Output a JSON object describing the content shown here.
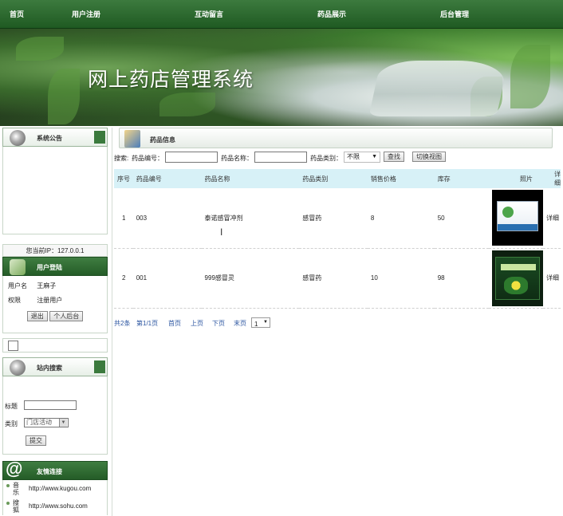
{
  "nav": [
    "首页",
    "用户注册",
    "互动留言",
    "药品展示",
    "后台管理"
  ],
  "banner": {
    "title": "网上药店管理系统"
  },
  "sidebar": {
    "notice_title": "系统公告",
    "ip_text": "您当前IP：127.0.0.1",
    "login_title": "用户登陆",
    "username_label": "用户名",
    "username_value": "王麻子",
    "role_label": "权限",
    "role_value": "注册用户",
    "logout_label": "退出",
    "backend_label": "个人后台",
    "search_title": "站内搜索",
    "search_title_label": "标题",
    "search_type_label": "类别",
    "search_type_value": "门店活动",
    "submit_label": "提交",
    "links_title": "友情连接",
    "links": [
      {
        "name": "音乐",
        "url": "http://www.kugou.com"
      },
      {
        "name": "搜狐",
        "url": "http://www.sohu.com"
      }
    ]
  },
  "main": {
    "panel_title": "药品信息",
    "filter": {
      "prefix": "搜索:",
      "code_label": "药品编号：",
      "name_label": "药品名称：",
      "type_label": "药品类别：",
      "type_value": "不限",
      "search_button": "查找",
      "switch_button": "切换视图"
    },
    "columns": [
      "序号",
      "药品编号",
      "药品名称",
      "药品类别",
      "销售价格",
      "库存",
      "照片",
      "详细"
    ],
    "rows": [
      {
        "no": "1",
        "code": "003",
        "name": "泰诺感冒冲剂",
        "type": "感冒药",
        "price": "8",
        "stock": "50",
        "detail": "详细"
      },
      {
        "no": "2",
        "code": "001",
        "name": "999感冒灵",
        "type": "感冒药",
        "price": "10",
        "stock": "98",
        "detail": "详细"
      }
    ],
    "pager": {
      "total": "共2条",
      "page": "第1/1页",
      "first": "首页",
      "prev": "上页",
      "next": "下页",
      "last": "末页",
      "select_value": "1"
    }
  }
}
